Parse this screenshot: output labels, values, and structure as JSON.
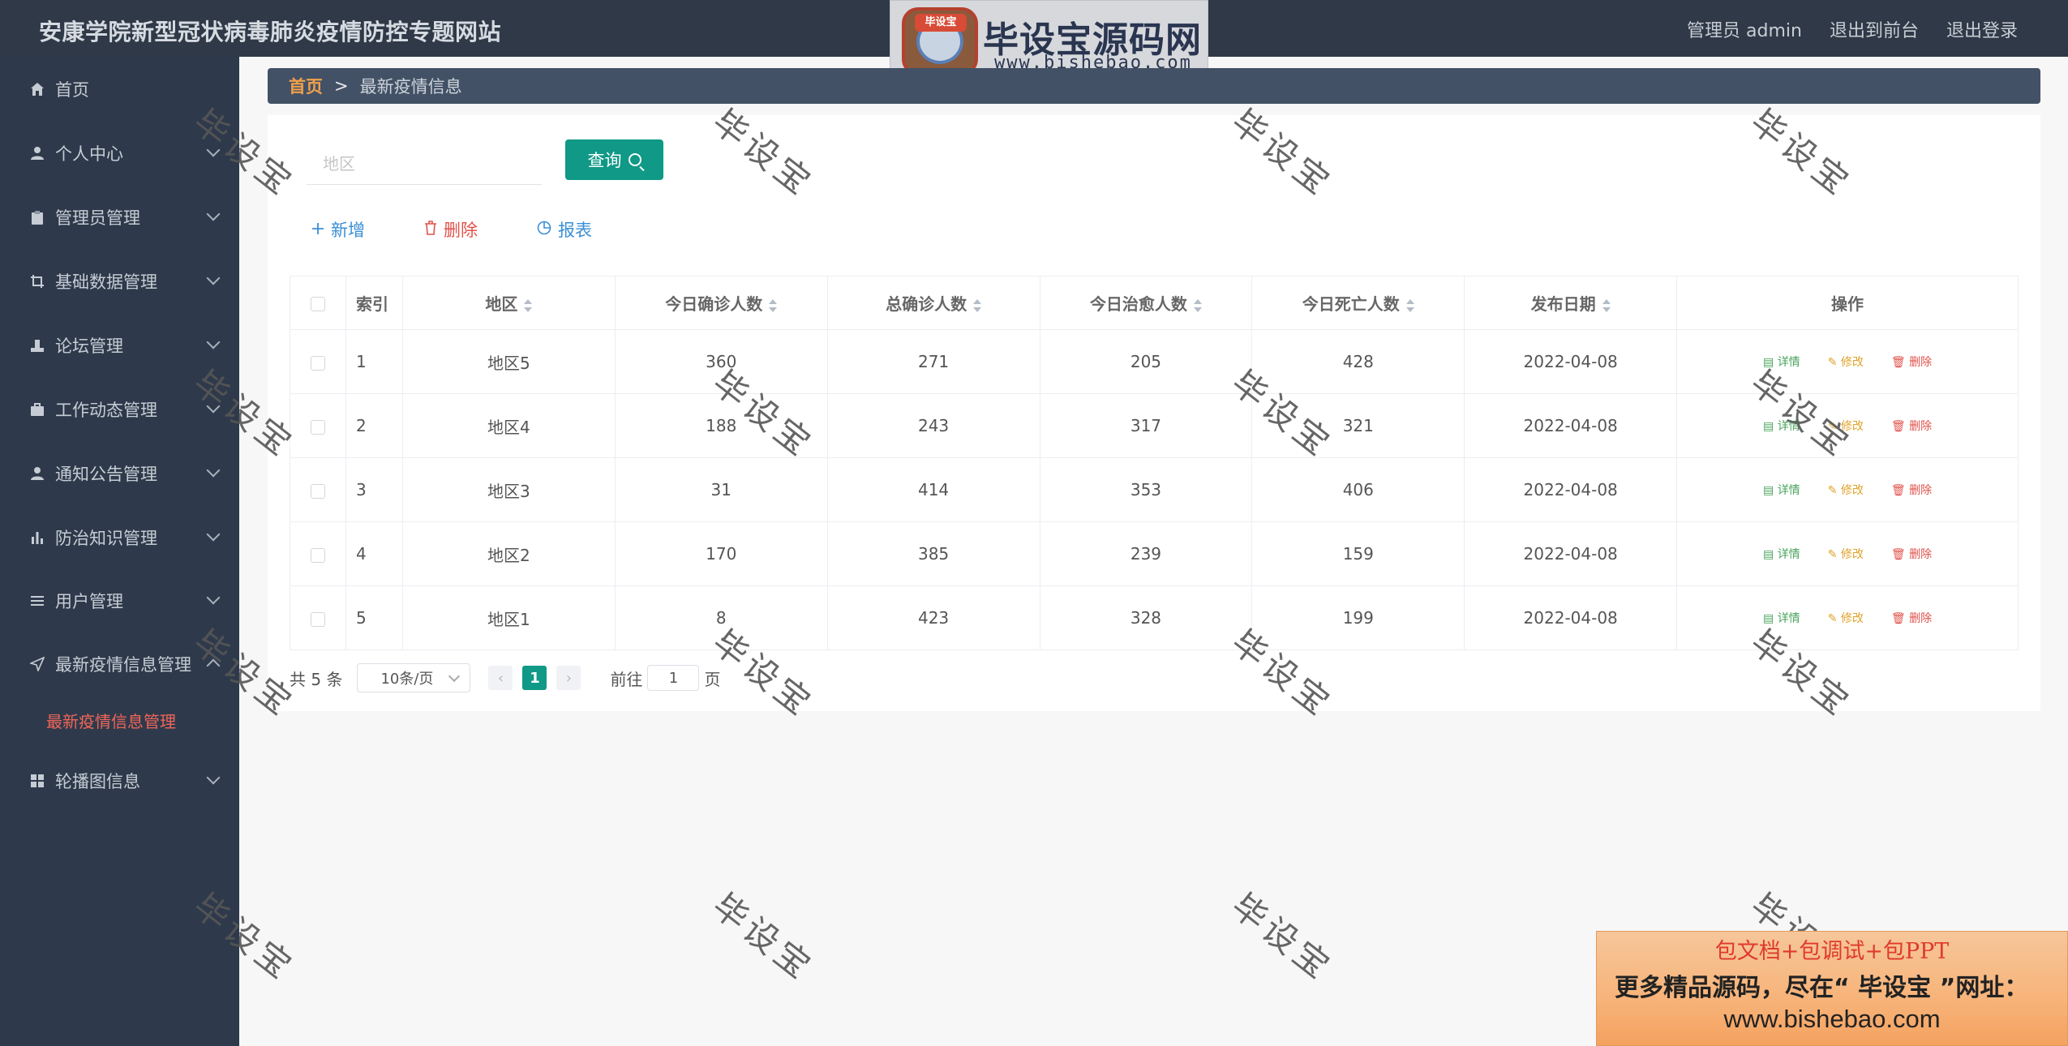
{
  "app": {
    "title": "安康学院新型冠状病毒肺炎疫情防控专题网站",
    "user_label": "管理员 admin",
    "front_label": "退出到前台",
    "logout_label": "退出登录"
  },
  "logo": {
    "badge_text": "毕设宝",
    "name": "毕设宝源码网",
    "url": "www.bishebao.com"
  },
  "sidebar": {
    "items": [
      {
        "label": "首页",
        "icon": "home-icon",
        "has_children": false
      },
      {
        "label": "个人中心",
        "icon": "user-icon",
        "has_children": true
      },
      {
        "label": "管理员管理",
        "icon": "clipboard-icon",
        "has_children": true
      },
      {
        "label": "基础数据管理",
        "icon": "crop-icon",
        "has_children": true
      },
      {
        "label": "论坛管理",
        "icon": "stamp-icon",
        "has_children": true
      },
      {
        "label": "工作动态管理",
        "icon": "briefcase-icon",
        "has_children": true
      },
      {
        "label": "通知公告管理",
        "icon": "user-icon",
        "has_children": true
      },
      {
        "label": "防治知识管理",
        "icon": "bar-chart-icon",
        "has_children": true
      },
      {
        "label": "用户管理",
        "icon": "list-icon",
        "has_children": true
      },
      {
        "label": "最新疫情信息管理",
        "icon": "send-icon",
        "has_children": true,
        "expanded": true
      },
      {
        "label": "轮播图信息",
        "icon": "grid-icon",
        "has_children": true
      }
    ],
    "active_sub": "最新疫情信息管理"
  },
  "breadcrumb": {
    "home": "首页",
    "separator": ">",
    "current": "最新疫情信息"
  },
  "search": {
    "placeholder": "地区",
    "button_label": "查询"
  },
  "actions": {
    "add": "新增",
    "delete": "删除",
    "report": "报表"
  },
  "table": {
    "columns": [
      "索引",
      "地区",
      "今日确诊人数",
      "总确诊人数",
      "今日治愈人数",
      "今日死亡人数",
      "发布日期",
      "操作"
    ],
    "rows": [
      {
        "index": "1",
        "region": "地区5",
        "today_confirmed": "360",
        "total_confirmed": "271",
        "today_cured": "205",
        "today_deaths": "428",
        "date": "2022-04-08"
      },
      {
        "index": "2",
        "region": "地区4",
        "today_confirmed": "188",
        "total_confirmed": "243",
        "today_cured": "317",
        "today_deaths": "321",
        "date": "2022-04-08"
      },
      {
        "index": "3",
        "region": "地区3",
        "today_confirmed": "31",
        "total_confirmed": "414",
        "today_cured": "353",
        "today_deaths": "406",
        "date": "2022-04-08"
      },
      {
        "index": "4",
        "region": "地区2",
        "today_confirmed": "170",
        "total_confirmed": "385",
        "today_cured": "239",
        "today_deaths": "159",
        "date": "2022-04-08"
      },
      {
        "index": "5",
        "region": "地区1",
        "today_confirmed": "8",
        "total_confirmed": "423",
        "today_cured": "328",
        "today_deaths": "199",
        "date": "2022-04-08"
      }
    ],
    "row_ops": {
      "detail": "详情",
      "edit": "修改",
      "delete": "删除"
    }
  },
  "pagination": {
    "total_text": "共 5 条",
    "page_size": "10条/页",
    "current_page": "1",
    "goto_label": "前往",
    "goto_value": "1",
    "page_suffix": "页"
  },
  "watermark": {
    "text": "毕设宝"
  },
  "ad": {
    "line1": "包文档+包调试+包PPT",
    "line2": "更多精品源码，尽在“ 毕设宝 ”网址：",
    "line3": "www.bishebao.com"
  },
  "colors": {
    "topbar": "#2f3947",
    "sidebar": "#2e3a4b",
    "accent": "#0f9986",
    "active_sub": "#f1655a",
    "breadcrumb_home": "#f0a04b"
  }
}
